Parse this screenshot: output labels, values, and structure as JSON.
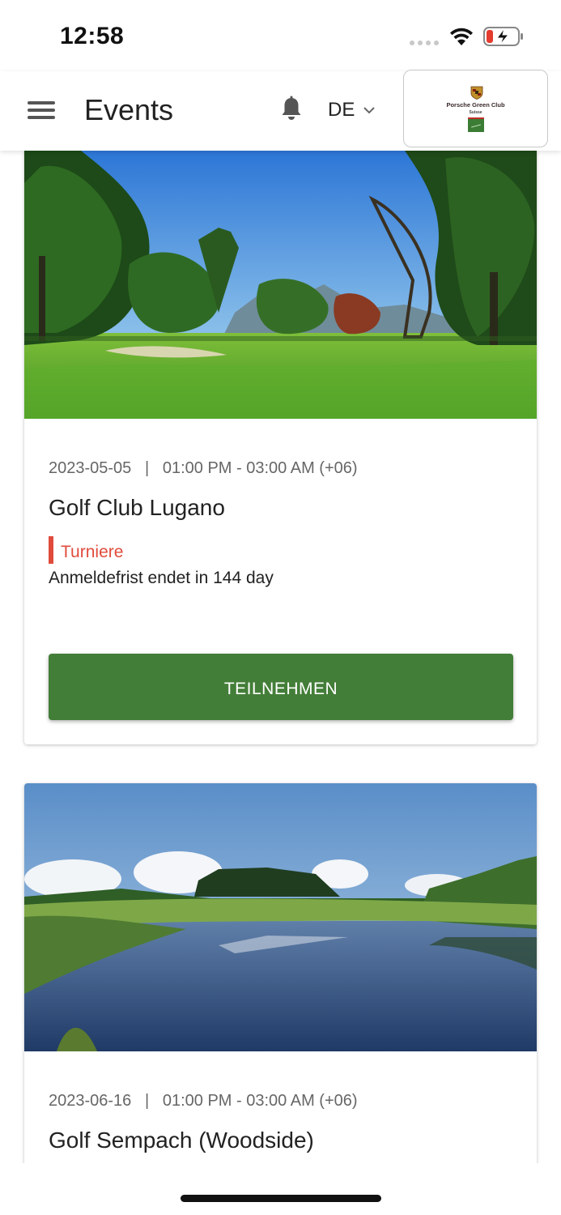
{
  "status_bar": {
    "time": "12:58"
  },
  "header": {
    "title": "Events",
    "language": "DE"
  },
  "logo": {
    "name": "Porsche Green Club",
    "sub": "Suisse"
  },
  "events": [
    {
      "date": "2023-05-05",
      "time": "01:00 PM - 03:00 AM (+06)",
      "title": "Golf Club Lugano",
      "category": "Turniere",
      "deadline": "Anmeldefrist endet in 144 day",
      "button": "TEILNEHMEN"
    },
    {
      "date": "2023-06-16",
      "time": "01:00 PM - 03:00 AM (+06)",
      "title": "Golf Sempach (Woodside)"
    }
  ],
  "colors": {
    "accent_green": "#437e38",
    "category_red": "#e04b3c"
  }
}
